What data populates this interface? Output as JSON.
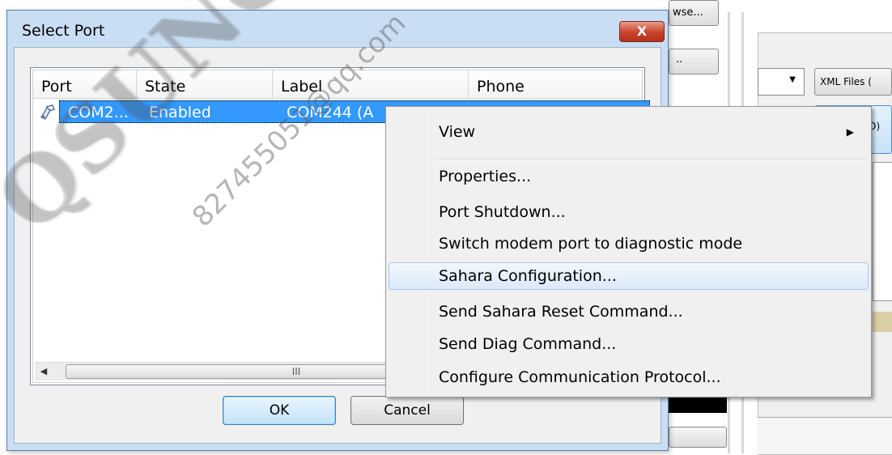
{
  "dialog": {
    "title": "Select Port",
    "close_glyph": "X",
    "columns": [
      "Port",
      "State",
      "Label",
      "Phone"
    ],
    "row": {
      "port": "COM2...",
      "state": "Enabled",
      "label": "COM244 (A"
    },
    "scroll_grip": "III",
    "ok_label": "OK",
    "cancel_label": "Cancel"
  },
  "context_menu": {
    "items": [
      {
        "label": "View",
        "has_submenu": true
      },
      {
        "label": "Properties..."
      },
      {
        "label": "Port Shutdown..."
      },
      {
        "label": "Switch modem port to diagnostic mode"
      },
      {
        "label": "Sahara Configuration...",
        "highlighted": true
      },
      {
        "label": "Send Sahara Reset Command..."
      },
      {
        "label": "Send Diag Command..."
      },
      {
        "label": "Configure Communication Protocol..."
      }
    ]
  },
  "background": {
    "browse_label": "wse...",
    "dots_label": "..",
    "xml_files_label": "XML Files (",
    "o_label": "O)"
  },
  "watermark": {
    "big": "QSUNCN",
    "small": "827455051@qq.com"
  },
  "colors": {
    "selection": "#3399ff",
    "dialog_frame": "#c9def3",
    "close_button": "#c8422c",
    "menu_highlight": "#dbeaf9"
  }
}
